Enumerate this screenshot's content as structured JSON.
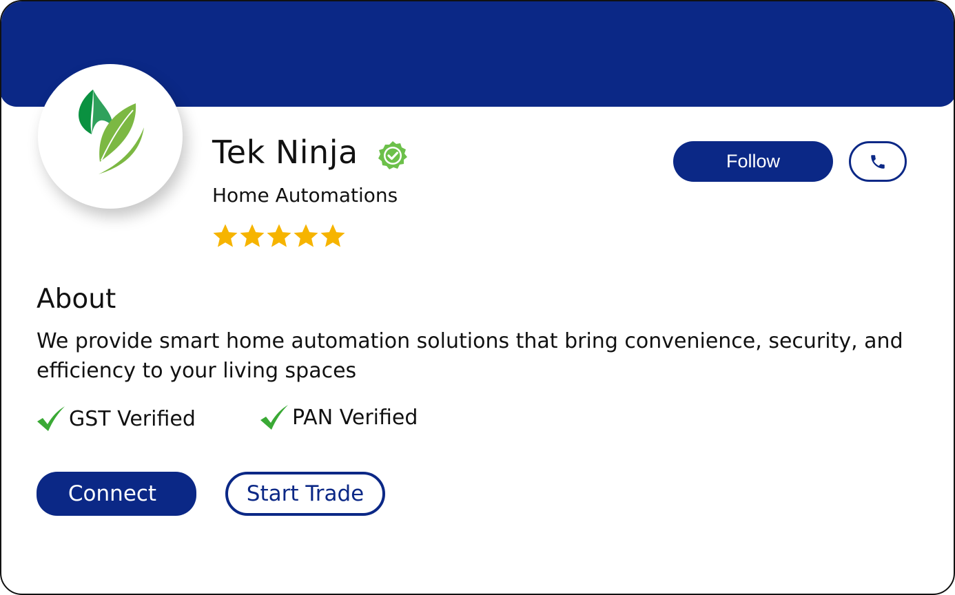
{
  "profile": {
    "name": "Tek Ninja",
    "category": "Home Automations",
    "rating": 5,
    "rating_max": 5
  },
  "actions": {
    "follow_label": "Follow",
    "call_icon": "phone-icon",
    "connect_label": "Connect",
    "trade_label": "Start Trade"
  },
  "about": {
    "title": "About",
    "text": "We provide smart home automation solutions that bring convenience, security, and efficiency to your living spaces"
  },
  "verifications": [
    {
      "label": "GST Verified",
      "icon": "checkmark-icon"
    },
    {
      "label": "PAN Verified",
      "icon": "checkmark-icon"
    }
  ],
  "icons": {
    "logo": "leaf-logo-icon",
    "badge": "verified-badge-icon",
    "star": "star-icon"
  },
  "colors": {
    "brand": "#0b2886",
    "badge": "#6cc04a",
    "star": "#f6b400",
    "check": "#3aa935",
    "leaf_dark": "#0a9140",
    "leaf_light": "#7cb843"
  }
}
